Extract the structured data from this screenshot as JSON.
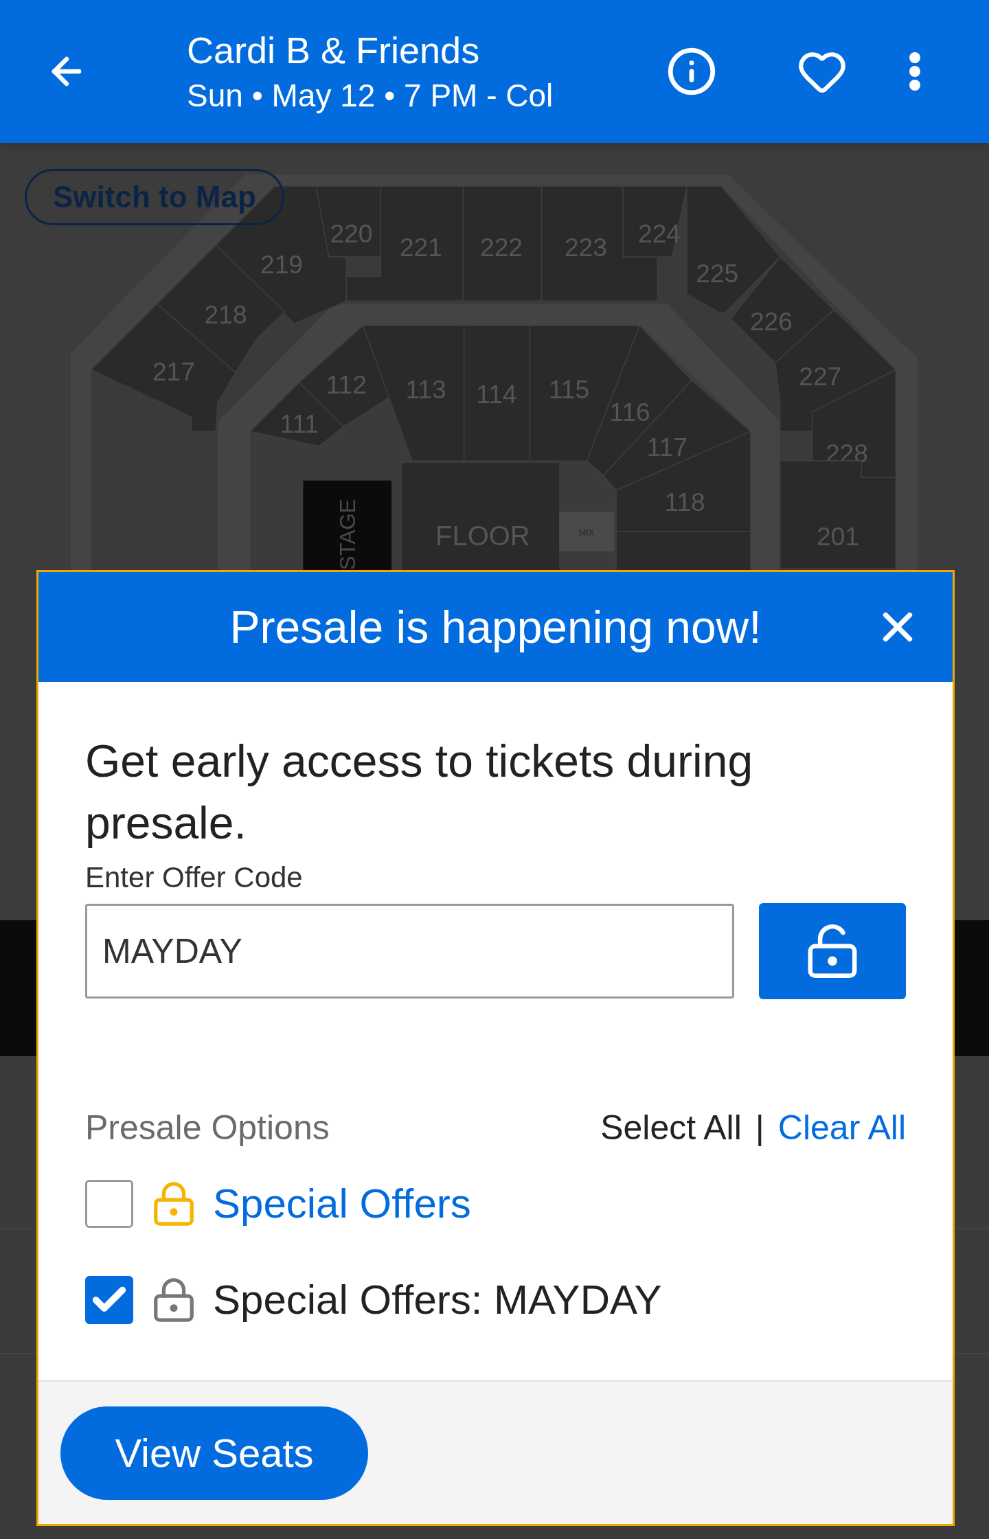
{
  "header": {
    "title": "Cardi B & Friends",
    "subtitle": "Sun • May 12 • 7 PM - Col"
  },
  "map": {
    "switch_button": "Switch to Map",
    "stage": "STAGE",
    "floor": "FLOOR",
    "mix": "MIX",
    "sections": [
      "220",
      "221",
      "222",
      "223",
      "224",
      "219",
      "225",
      "218",
      "226",
      "217",
      "227",
      "228",
      "201",
      "112",
      "111",
      "113",
      "114",
      "115",
      "116",
      "117",
      "118"
    ]
  },
  "modal": {
    "title": "Presale is happening now!",
    "heading": "Get early access to tickets during presale.",
    "code_label": "Enter Offer Code",
    "code_field": {
      "value": "MAYDAY"
    },
    "options_label": "Presale Options",
    "select_all": "Select All",
    "separator": "|",
    "clear_all": "Clear All",
    "options": [
      {
        "label": "Special Offers",
        "checked": false
      },
      {
        "label": "Special Offers: MAYDAY",
        "checked": true
      }
    ],
    "view_seats": "View Seats"
  }
}
